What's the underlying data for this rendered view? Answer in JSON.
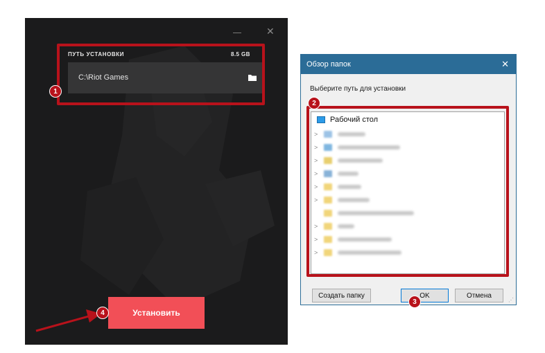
{
  "installer": {
    "path_label": "ПУТЬ УСТАНОВКИ",
    "size_label": "8.5 GB",
    "path_value": "C:\\Riot Games",
    "install_label": "Установить",
    "minimize_icon": "minimize-icon",
    "close_icon": "close-icon",
    "folder_icon": "folder-icon"
  },
  "dialog": {
    "title": "Обзор папок",
    "prompt": "Выберите путь для установки",
    "tree_root": "Рабочий стол",
    "new_folder_label": "Создать папку",
    "ok_label": "OK",
    "cancel_label": "Отмена"
  },
  "annotations": {
    "badge_1": "1",
    "badge_2": "2",
    "badge_3": "3",
    "badge_4": "4"
  },
  "colors": {
    "installer_bg": "#1b1b1c",
    "install_button": "#f24f57",
    "highlight": "#b8121b",
    "dialog_title": "#2b6c97"
  }
}
